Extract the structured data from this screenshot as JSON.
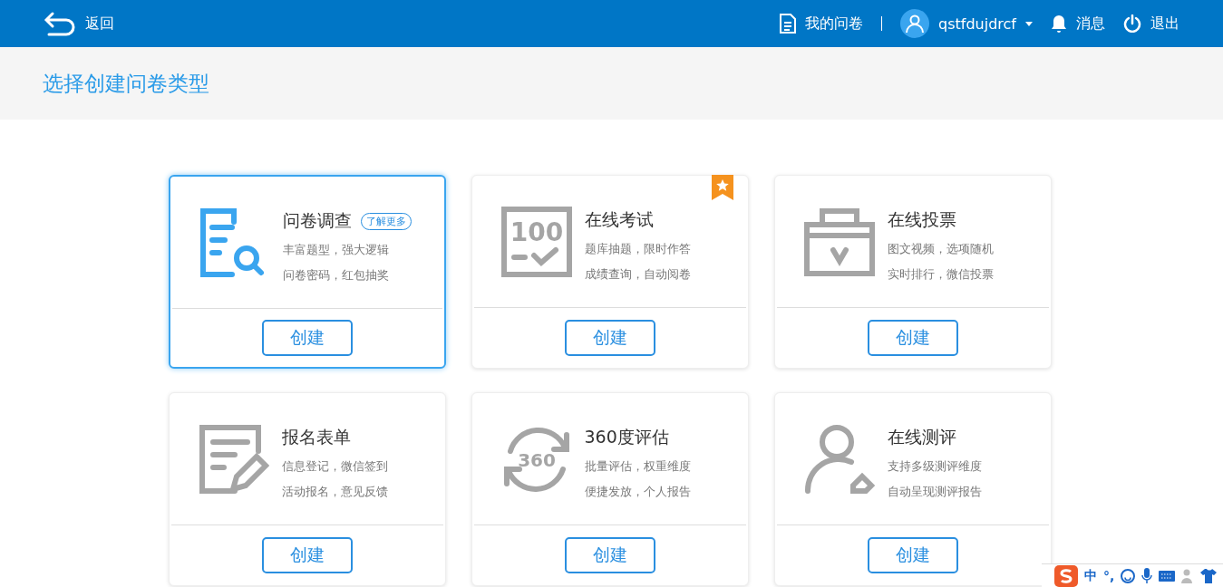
{
  "header": {
    "back": "返回",
    "my_surveys": "我的问卷",
    "user": "qstfdujdrcf",
    "messages": "消息",
    "logout": "退出"
  },
  "page_title": "选择创建问卷类型",
  "cards": [
    {
      "kind": "survey",
      "title": "问卷调查",
      "badge": "了解更多",
      "lines": [
        "丰富题型，强大逻辑",
        "问卷密码，红包抽奖"
      ],
      "button": "创建",
      "selected": true,
      "ribbon": false
    },
    {
      "kind": "exam",
      "icon_text": "100",
      "title": "在线考试",
      "lines": [
        "题库抽题，限时作答",
        "成绩查询，自动阅卷"
      ],
      "button": "创建",
      "selected": false,
      "ribbon": true
    },
    {
      "kind": "vote",
      "title": "在线投票",
      "lines": [
        "图文视频，选项随机",
        "实时排行，微信投票"
      ],
      "button": "创建",
      "selected": false,
      "ribbon": false
    },
    {
      "kind": "form",
      "title": "报名表单",
      "lines": [
        "信息登记，微信签到",
        "活动报名，意见反馈"
      ],
      "button": "创建",
      "selected": false,
      "ribbon": false
    },
    {
      "kind": "review",
      "icon_text": "360",
      "title": "360度评估",
      "lines": [
        "批量评估，权重维度",
        "便捷发放，个人报告"
      ],
      "button": "创建",
      "selected": false,
      "ribbon": false
    },
    {
      "kind": "assess",
      "title": "在线测评",
      "lines": [
        "支持多级测评维度",
        "自动呈现测评报告"
      ],
      "button": "创建",
      "selected": false,
      "ribbon": false
    }
  ],
  "ime_toolbar": {
    "mode": "中",
    "punct": "°,"
  }
}
